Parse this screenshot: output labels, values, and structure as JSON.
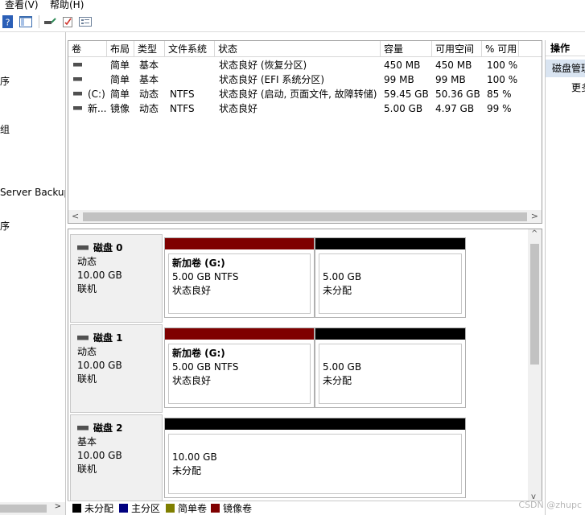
{
  "menu": {
    "view": "查看(V)",
    "help": "帮助(H)"
  },
  "left_nav": [
    "序",
    "组",
    "Server Backup",
    "序"
  ],
  "volumes": {
    "columns": [
      "卷",
      "布局",
      "类型",
      "文件系统",
      "状态",
      "容量",
      "可用空间",
      "% 可用"
    ],
    "rows": [
      {
        "vol": "",
        "layout": "简单",
        "type": "基本",
        "fs": "",
        "status": "状态良好 (恢复分区)",
        "capacity": "450 MB",
        "free": "450 MB",
        "pct": "100 %"
      },
      {
        "vol": "",
        "layout": "简单",
        "type": "基本",
        "fs": "",
        "status": "状态良好 (EFI 系统分区)",
        "capacity": "99 MB",
        "free": "99 MB",
        "pct": "100 %"
      },
      {
        "vol": "(C:)",
        "layout": "简单",
        "type": "动态",
        "fs": "NTFS",
        "status": "状态良好 (启动, 页面文件, 故障转储)",
        "capacity": "59.45 GB",
        "free": "50.36 GB",
        "pct": "85 %"
      },
      {
        "vol": "新...",
        "layout": "镜像",
        "type": "动态",
        "fs": "NTFS",
        "status": "状态良好",
        "capacity": "5.00 GB",
        "free": "4.97 GB",
        "pct": "99 %"
      }
    ]
  },
  "disks": [
    {
      "name": "磁盘 0",
      "type": "动态",
      "size": "10.00 GB",
      "state": "联机",
      "parts": [
        {
          "title": "新加卷  (G:)",
          "line1": "5.00 GB NTFS",
          "line2": "状态良好",
          "color": "#7f0000"
        },
        {
          "title": "",
          "line1": "5.00 GB",
          "line2": "未分配",
          "color": "#000000"
        }
      ]
    },
    {
      "name": "磁盘 1",
      "type": "动态",
      "size": "10.00 GB",
      "state": "联机",
      "parts": [
        {
          "title": "新加卷  (G:)",
          "line1": "5.00 GB NTFS",
          "line2": "状态良好",
          "color": "#7f0000"
        },
        {
          "title": "",
          "line1": "5.00 GB",
          "line2": "未分配",
          "color": "#000000"
        }
      ]
    },
    {
      "name": "磁盘 2",
      "type": "基本",
      "size": "10.00 GB",
      "state": "联机",
      "parts": [
        {
          "title": "",
          "line1": "10.00 GB",
          "line2": "未分配",
          "color": "#000000"
        }
      ]
    }
  ],
  "legend": [
    {
      "label": "未分配",
      "color": "#000000"
    },
    {
      "label": "主分区",
      "color": "#00007f"
    },
    {
      "label": "简单卷",
      "color": "#7f7f00"
    },
    {
      "label": "镜像卷",
      "color": "#7f0000"
    }
  ],
  "actions": {
    "header": "操作",
    "selected": "磁盘管理",
    "more": "更多"
  },
  "watermark": "CSDN @zhupc"
}
